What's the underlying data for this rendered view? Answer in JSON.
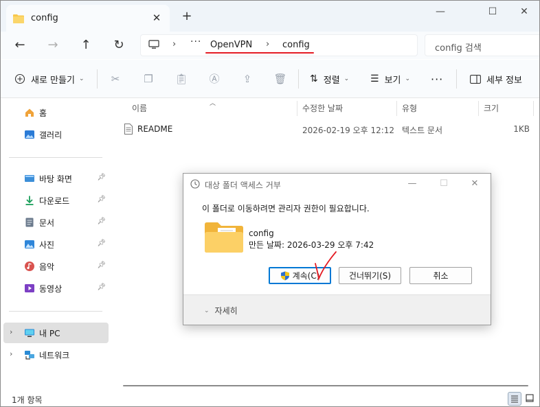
{
  "tab": {
    "title": "config",
    "close": "✕"
  },
  "window_controls": {
    "minimize": "—",
    "maximize": "☐",
    "close": "✕",
    "new_tab": "+"
  },
  "nav": {
    "back": "←",
    "forward": "→",
    "up": "↑",
    "refresh": "↻"
  },
  "address": {
    "more": "···",
    "crumbs": [
      "OpenVPN",
      "config"
    ],
    "sep": "›"
  },
  "search": {
    "placeholder": "config 검색"
  },
  "toolbar": {
    "new_label": "새로 만들기",
    "sort_label": "정렬",
    "view_label": "보기",
    "more": "···",
    "details_label": "세부 정보"
  },
  "sidebar": {
    "items": [
      {
        "label": "홈"
      },
      {
        "label": "갤러리"
      },
      {
        "label": "바탕 화면"
      },
      {
        "label": "다운로드"
      },
      {
        "label": "문서"
      },
      {
        "label": "사진"
      },
      {
        "label": "음악"
      },
      {
        "label": "동영상"
      },
      {
        "label": "내 PC"
      },
      {
        "label": "네트워크"
      }
    ]
  },
  "columns": {
    "name": "이름",
    "modified": "수정한 날짜",
    "type": "유형",
    "size": "크기"
  },
  "files": [
    {
      "name": "README",
      "modified": "2026-02-19 오후 12:12",
      "type": "텍스트 문서",
      "size": "1KB"
    }
  ],
  "status": {
    "count": "1개 항목"
  },
  "dialog": {
    "title": "대상 폴더 액세스 거부",
    "message": "이 폴더로 이동하려면 관리자 권한이 필요합니다.",
    "folder_name": "config",
    "folder_date": "만든 날짜: 2026-03-29 오후 7:42",
    "continue_label": "계속(C)",
    "skip_label": "건너뛰기(S)",
    "cancel_label": "취소",
    "details_label": "자세히"
  },
  "colors": {
    "accent": "#0078d4",
    "folder": "#f8c74a",
    "annotation": "#e41b23"
  }
}
